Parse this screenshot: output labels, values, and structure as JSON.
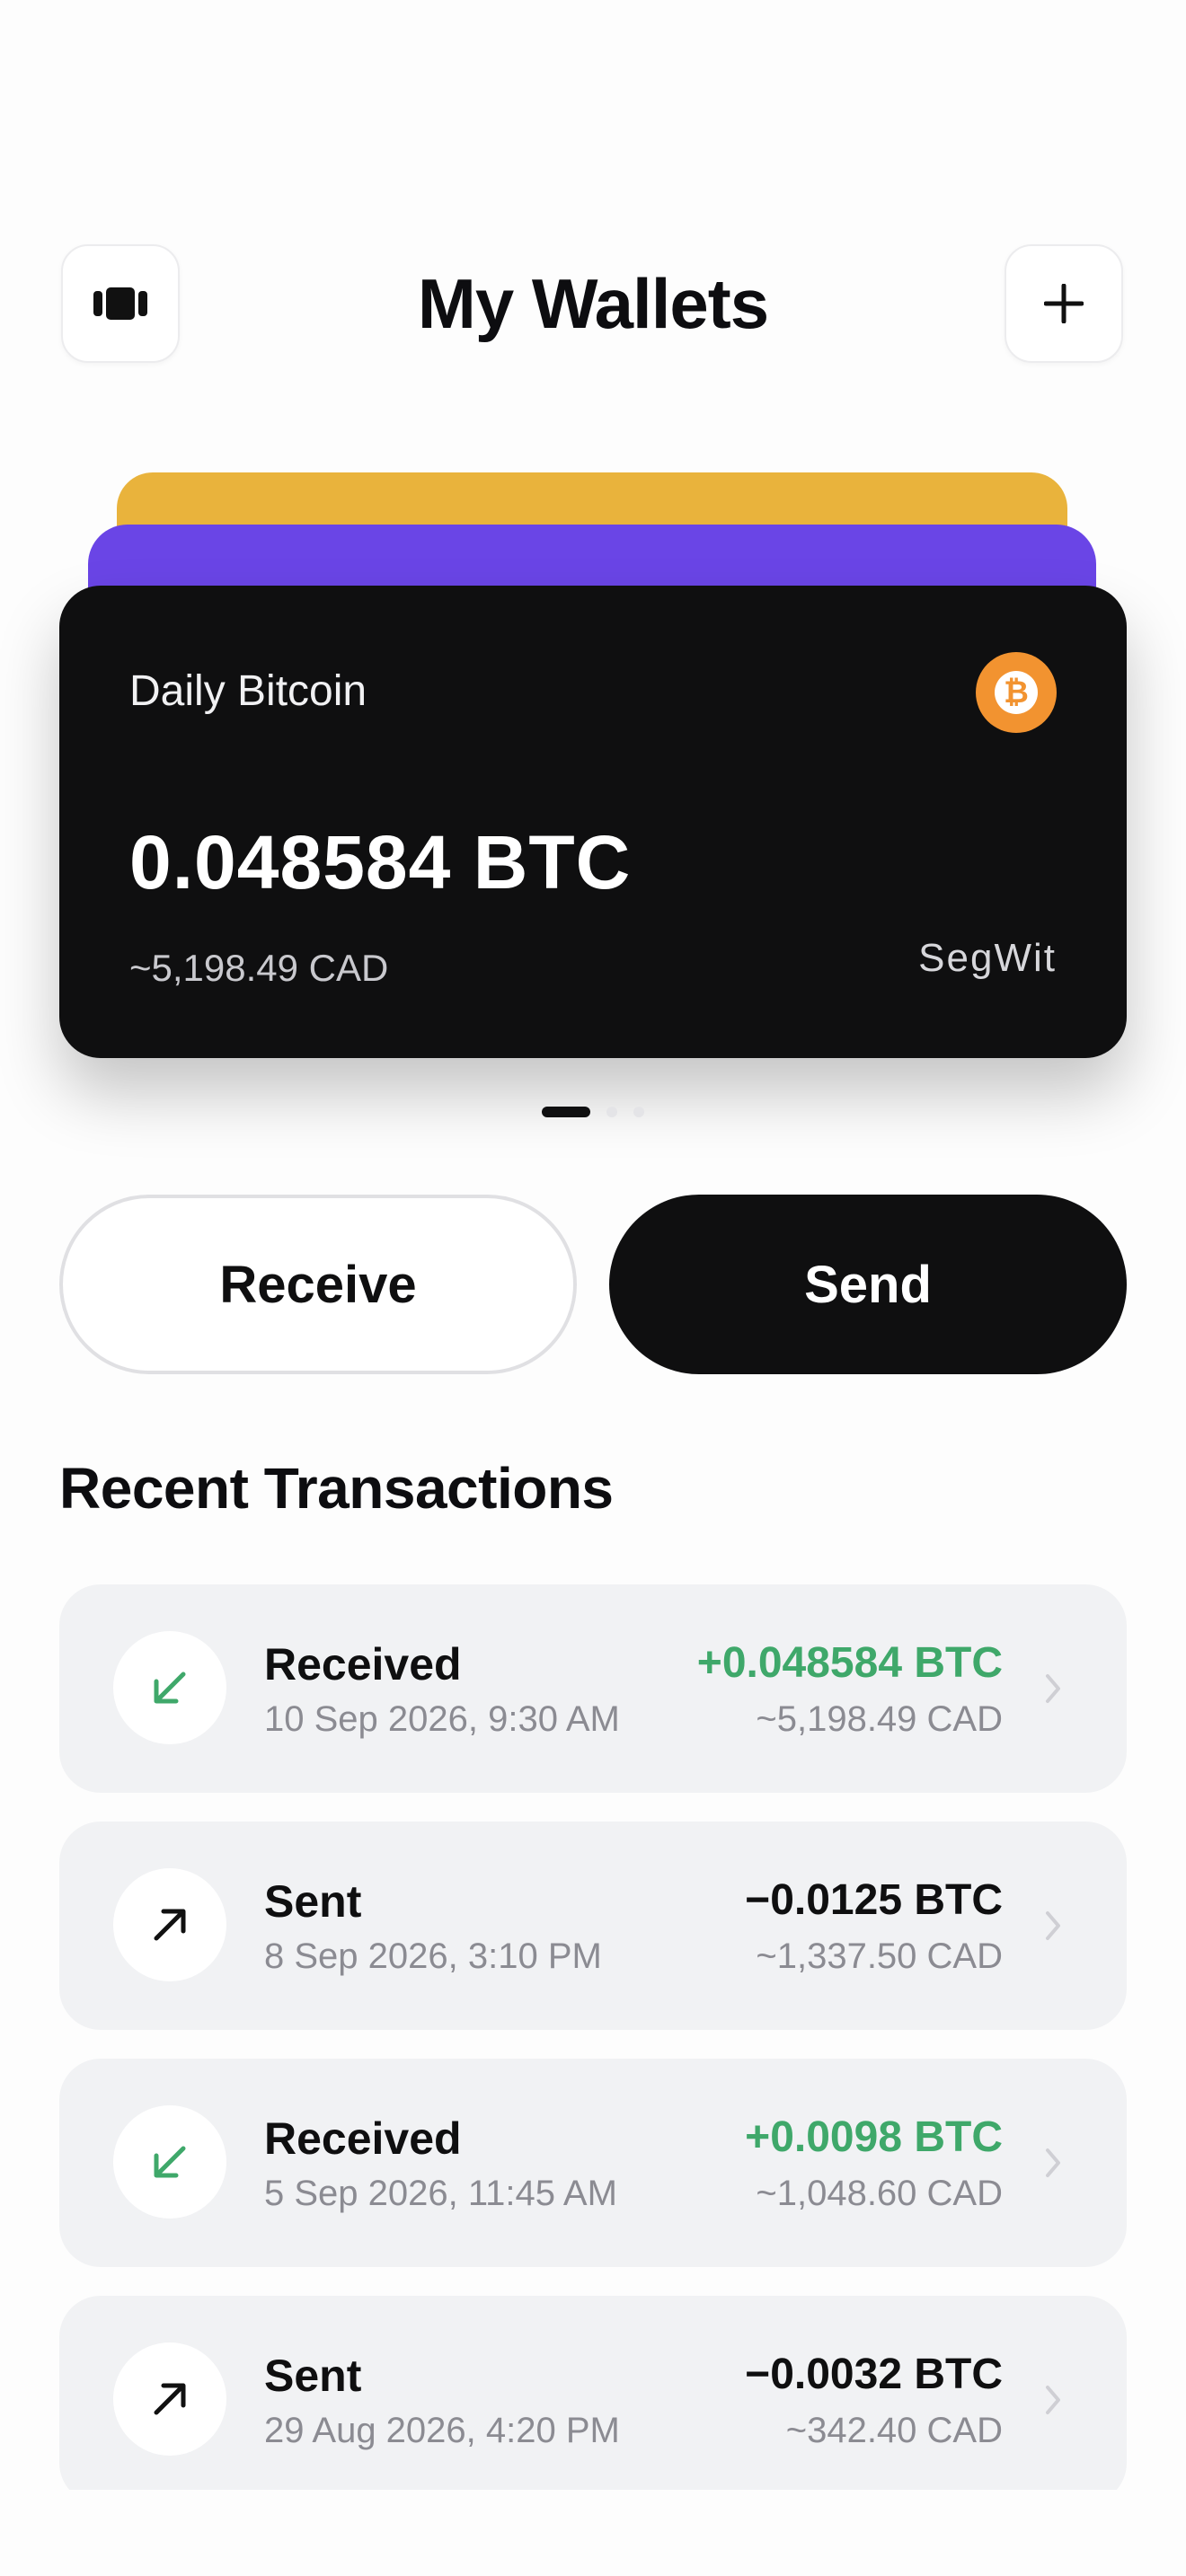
{
  "header": {
    "title": "My Wallets",
    "menu_icon": "wallet-stack-icon",
    "add_icon": "plus-icon"
  },
  "wallet": {
    "name": "Daily Bitcoin",
    "balance": "0.048584 BTC",
    "fiat": "~5,198.49 CAD",
    "type": "SegWit",
    "coin_symbol": "₿",
    "card_color": "#0f0f10",
    "back_card_colors": [
      "#e9b33c",
      "#6a45e6"
    ]
  },
  "pager": {
    "count": 3,
    "active": 1
  },
  "actions": {
    "receive_label": "Receive",
    "send_label": "Send"
  },
  "transactions_title": "Recent Transactions",
  "colors": {
    "positive": "#3fa86a",
    "negative": "#0f0f10",
    "bitcoin": "#f29330"
  },
  "transactions": [
    {
      "title": "Received",
      "date": "10 Sep 2026, 9:30 AM",
      "amount": "+0.048584 BTC",
      "fiat": "~5,198.49 CAD",
      "direction": "in",
      "icon": "arrow-down-left-icon"
    },
    {
      "title": "Sent",
      "date": "8 Sep 2026, 3:10 PM",
      "amount": "−0.0125 BTC",
      "fiat": "~1,337.50 CAD",
      "direction": "out",
      "icon": "arrow-up-right-icon"
    },
    {
      "title": "Received",
      "date": "5 Sep 2026, 11:45 AM",
      "amount": "+0.0098 BTC",
      "fiat": "~1,048.60 CAD",
      "direction": "in",
      "icon": "arrow-down-left-icon"
    },
    {
      "title": "Sent",
      "date": "29 Aug 2026, 4:20 PM",
      "amount": "−0.0032 BTC",
      "fiat": "~342.40 CAD",
      "direction": "out",
      "icon": "arrow-up-right-icon"
    }
  ]
}
